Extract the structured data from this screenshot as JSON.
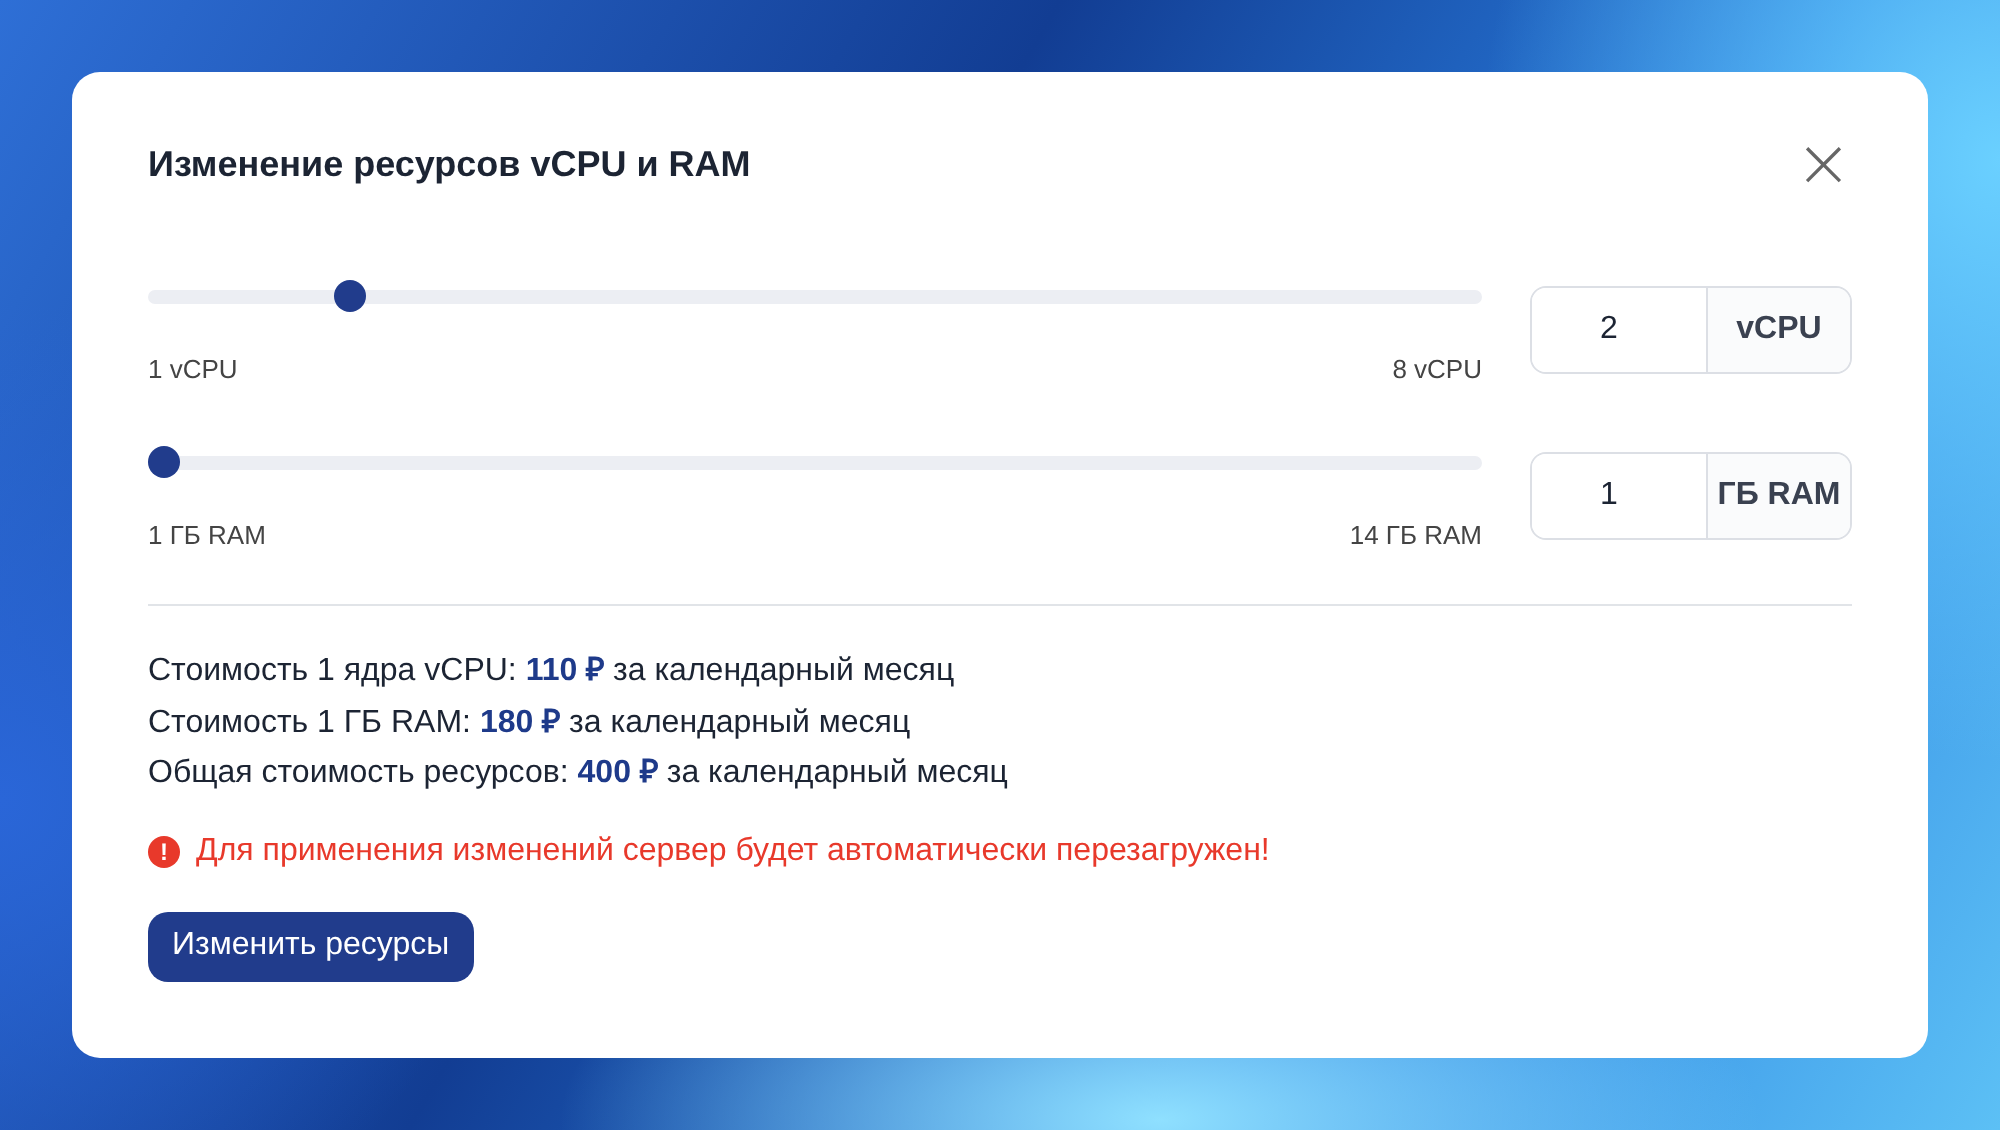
{
  "dialog": {
    "title": "Изменение ресурсов vCPU и RAM",
    "close": "×"
  },
  "sliders": [
    {
      "level": 0.143,
      "min_label": "1 vCPU",
      "max_label": "8 vCPU",
      "value": "2",
      "unit": "vCPU"
    },
    {
      "level": 0,
      "min_label": "1 ГБ RAM",
      "max_label": "14 ГБ RAM",
      "value": "1",
      "unit": "ГБ RAM"
    }
  ],
  "prices": [
    "Стоимость 1 ядра vCPU: **110 ₽** за календарный месяц",
    "Стоимость 1 ГБ RAM: **180 ₽** за календарный месяц",
    "Общая стоимость ресурсов: **400 ₽** за календарный месяц"
  ],
  "warning": {
    "icon": "!",
    "text": "Для применения изменений сервер будет автоматически перезагружен!"
  },
  "button": "Изменить ресурсы"
}
